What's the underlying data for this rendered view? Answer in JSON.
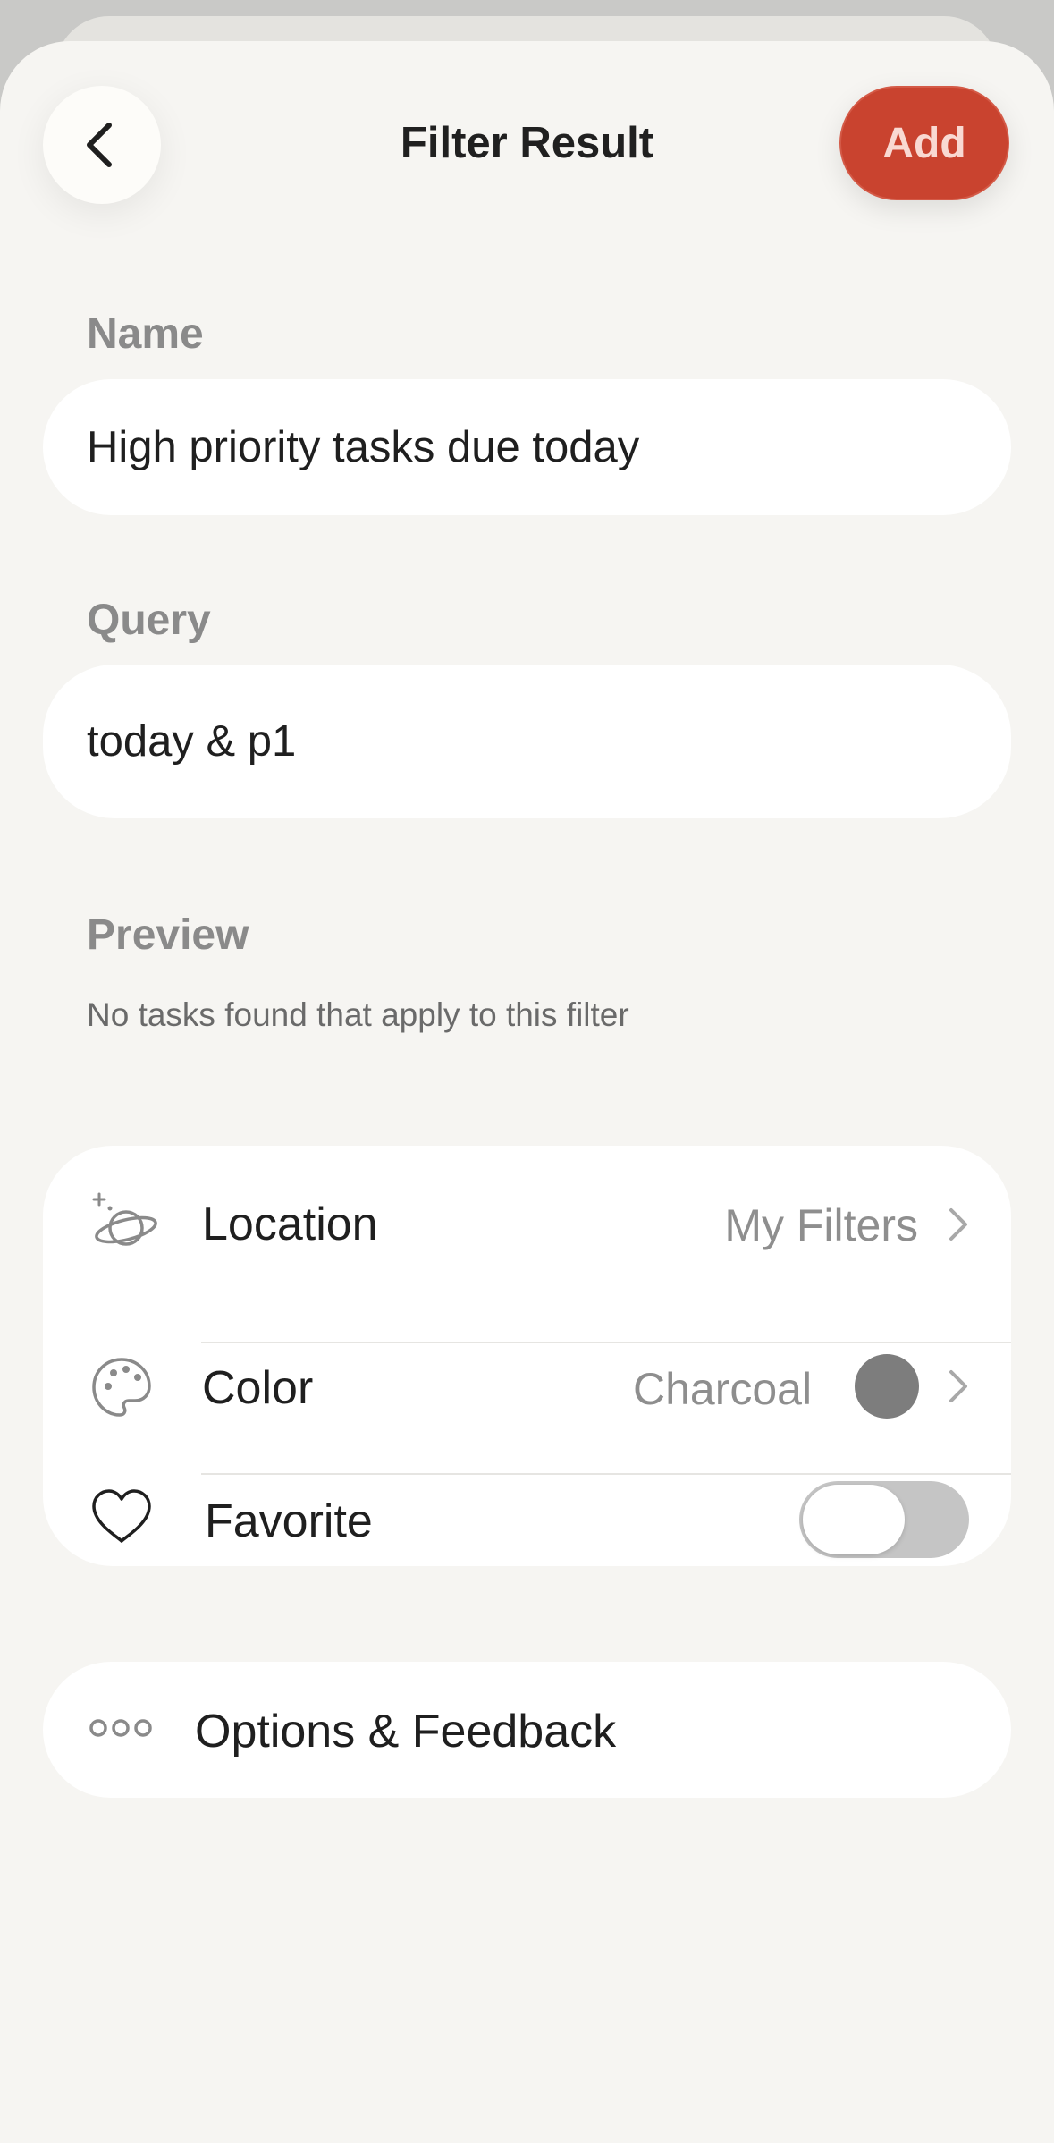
{
  "header": {
    "title": "Filter Result",
    "add_label": "Add"
  },
  "name_field": {
    "label": "Name",
    "value": "High priority tasks due today"
  },
  "query_field": {
    "label": "Query",
    "value": "today & p1"
  },
  "preview": {
    "label": "Preview",
    "message": "No tasks found that apply to this filter"
  },
  "settings": {
    "location": {
      "label": "Location",
      "value": "My Filters",
      "icon": "planet-icon"
    },
    "color": {
      "label": "Color",
      "value": "Charcoal",
      "swatch": "#7d7d7d",
      "icon": "palette-icon"
    },
    "favorite": {
      "label": "Favorite",
      "enabled": false,
      "icon": "heart-icon"
    }
  },
  "options": {
    "label": "Options & Feedback",
    "icon": "more-dots-icon"
  },
  "colors": {
    "accent": "#c9432f",
    "background": "#f6f5f2"
  }
}
